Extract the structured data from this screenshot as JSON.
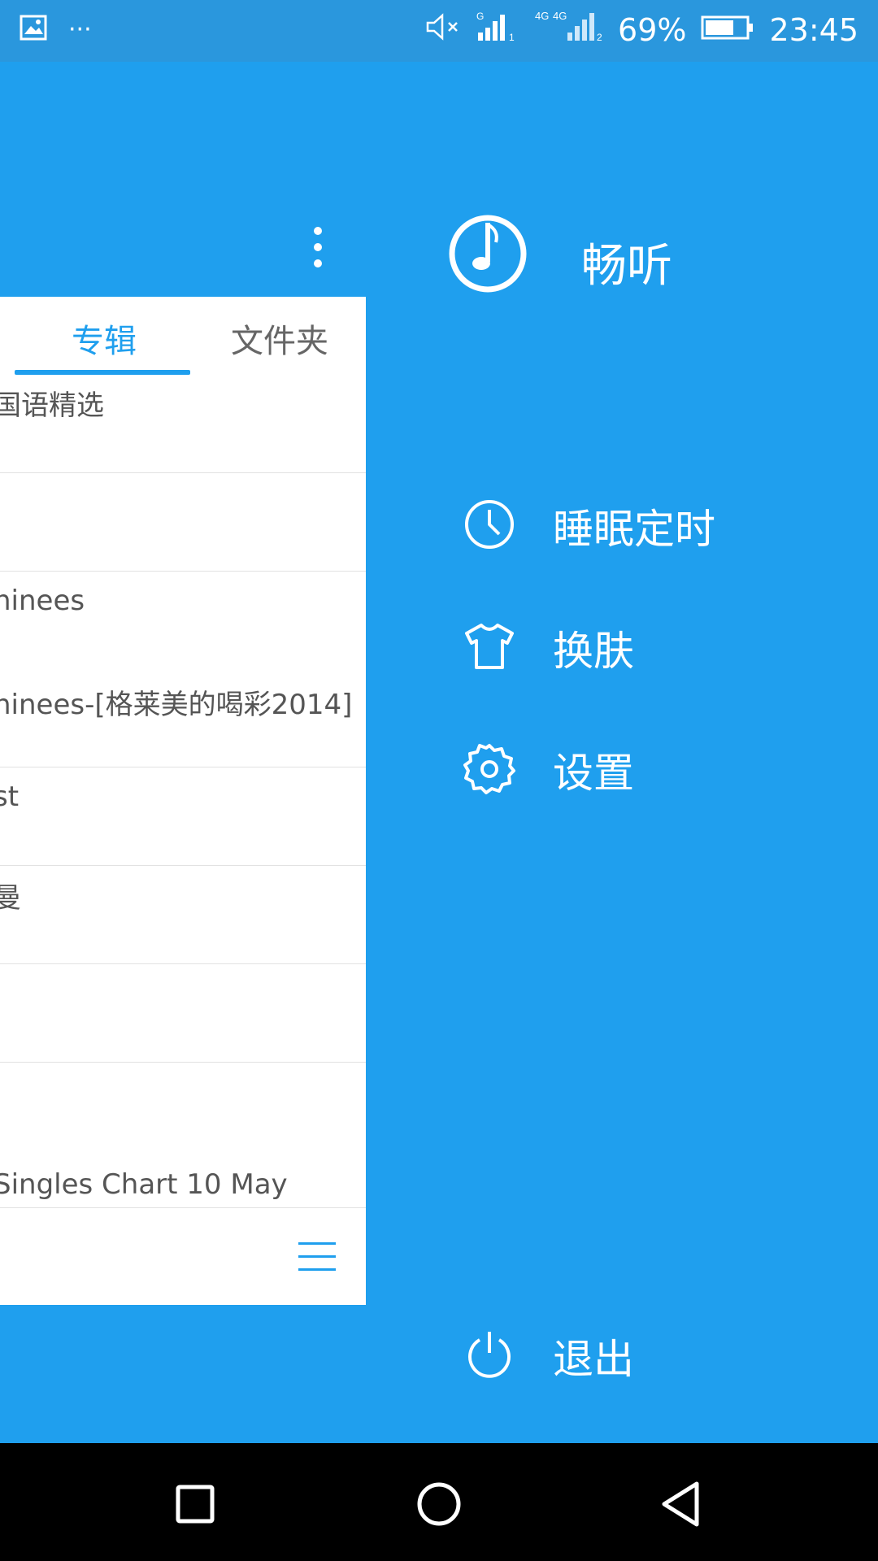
{
  "status_bar": {
    "battery_text": "69%",
    "time": "23:45",
    "left_icons": [
      "image-icon",
      "more-dots-icon"
    ],
    "right_icons": [
      "mute-icon",
      "signal-icon",
      "signal-4g-icon",
      "battery-icon"
    ],
    "sim1_label": "1",
    "sim2_label": "2",
    "network_label_1": "G",
    "network_label_2": "4G",
    "network_label_3": "4G"
  },
  "tabs": [
    {
      "label": "专辑",
      "active": true
    },
    {
      "label": "文件夹",
      "active": false
    }
  ],
  "album_list": [
    {
      "text": "国语精选"
    },
    {
      "text": ""
    },
    {
      "text": "ninees"
    },
    {
      "text": "ninees-[格莱美的喝彩2014]"
    },
    {
      "text": "st"
    },
    {
      "text": "曼"
    },
    {
      "text": ""
    },
    {
      "text": "Singles Chart 10 May"
    }
  ],
  "drawer": {
    "title": "畅听",
    "items": [
      {
        "label": "睡眠定时",
        "icon": "clock-icon"
      },
      {
        "label": "换肤",
        "icon": "tshirt-icon"
      },
      {
        "label": "设置",
        "icon": "gear-icon"
      }
    ],
    "exit_label": "退出"
  },
  "colors": {
    "primary": "#1f9fee",
    "status_bar": "#2a97dd",
    "panel_bg": "#ffffff",
    "nav_bg": "#000000"
  }
}
